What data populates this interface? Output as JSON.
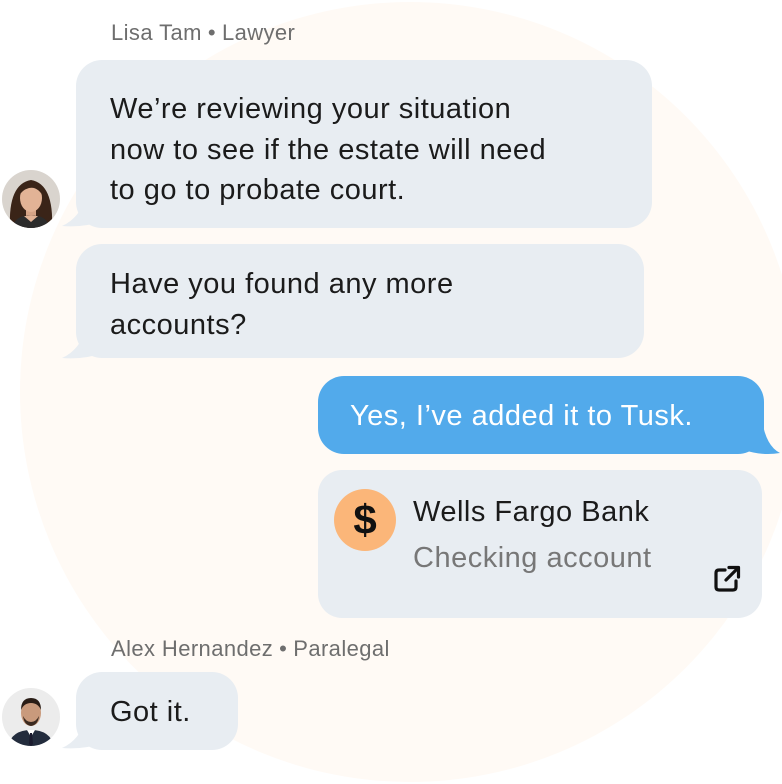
{
  "thread": [
    {
      "sender_name": "Lisa Tam",
      "sender_separator": "•",
      "sender_role": "Lawyer",
      "avatar_icon": "woman-portrait-avatar",
      "messages": [
        {
          "lines": [
            "We’re reviewing your situation",
            "now to see if the estate will need",
            "to go to probate court."
          ]
        },
        {
          "lines": [
            "Have you found any more",
            "accounts?"
          ]
        }
      ]
    },
    {
      "sender": "user",
      "messages": [
        {
          "text": "Yes, I’ve added it to Tusk."
        }
      ],
      "attachment": {
        "icon": "dollar-sign-icon",
        "icon_glyph": "$",
        "title": "Wells Fargo Bank",
        "subtitle": "Checking account",
        "action_icon": "external-link-icon"
      }
    },
    {
      "sender_name": "Alex Hernandez",
      "sender_separator": "•",
      "sender_role": "Paralegal",
      "avatar_icon": "man-portrait-avatar",
      "messages": [
        {
          "text": "Got it."
        }
      ]
    }
  ],
  "colors": {
    "incoming_bubble": "#e8edf2",
    "outgoing_bubble": "#52aaeb",
    "coin": "#fbb679",
    "background_circle": "#fffaf5",
    "sender_text": "#6e6e6e"
  }
}
